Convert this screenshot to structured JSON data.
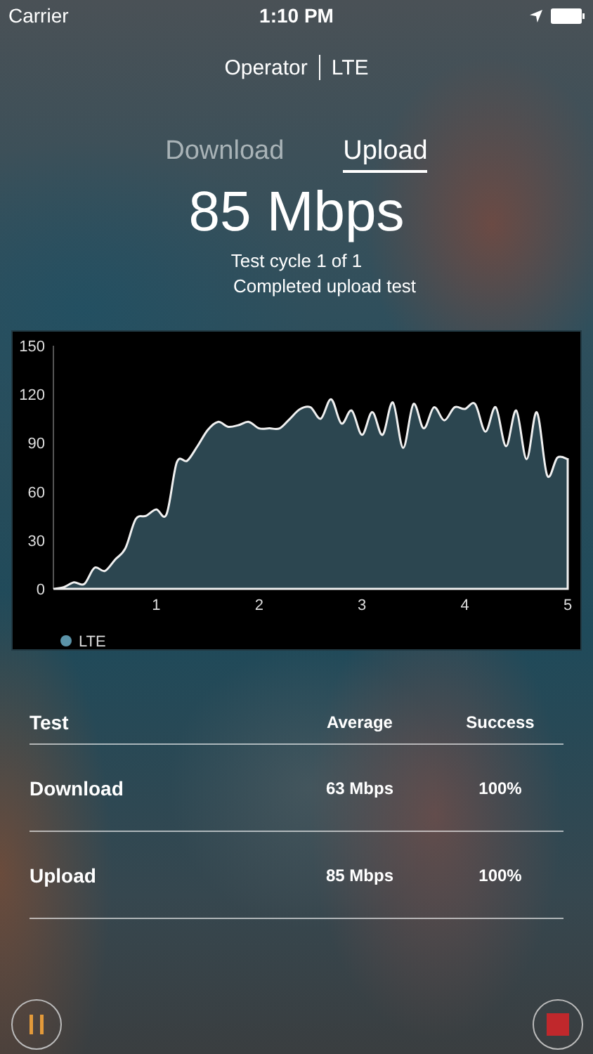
{
  "status_bar": {
    "carrier": "Carrier",
    "time": "1:10 PM"
  },
  "connection": {
    "operator": "Operator",
    "network": "LTE"
  },
  "tabs": [
    {
      "label": "Download",
      "selected": false
    },
    {
      "label": "Upload",
      "selected": true
    }
  ],
  "speed": "85 Mbps",
  "cycle": "Test cycle  1 of 1",
  "status": "Completed upload test",
  "chart_data": {
    "type": "area",
    "x": [
      0,
      0.1,
      0.2,
      0.3,
      0.4,
      0.5,
      0.6,
      0.7,
      0.8,
      0.9,
      1,
      1.1,
      1.2,
      1.3,
      1.4,
      1.5,
      1.6,
      1.7,
      1.8,
      1.9,
      2,
      2.1,
      2.2,
      2.3,
      2.4,
      2.5,
      2.6,
      2.7,
      2.8,
      2.9,
      3,
      3.1,
      3.2,
      3.3,
      3.4,
      3.5,
      3.6,
      3.7,
      3.8,
      3.9,
      4,
      4.1,
      4.2,
      4.3,
      4.4,
      4.5,
      4.6,
      4.7,
      4.8,
      4.9,
      5
    ],
    "series": [
      {
        "name": "LTE",
        "color": "#5b93a8",
        "values": [
          0,
          1,
          4,
          3,
          13,
          11,
          18,
          25,
          43,
          45,
          49,
          46,
          78,
          79,
          88,
          98,
          103,
          100,
          101,
          103,
          99,
          99,
          99,
          105,
          111,
          112,
          105,
          117,
          102,
          110,
          95,
          109,
          95,
          115,
          87,
          114,
          99,
          112,
          104,
          112,
          111,
          114,
          97,
          112,
          88,
          110,
          80,
          109,
          70,
          81,
          80
        ]
      }
    ],
    "xlim": [
      0,
      5
    ],
    "ylim": [
      0,
      150
    ],
    "xticks": [
      1,
      2,
      3,
      4,
      5
    ],
    "yticks": [
      0,
      30,
      60,
      90,
      120,
      150
    ]
  },
  "results": {
    "columns": [
      "Test",
      "Average",
      "Success"
    ],
    "rows": [
      {
        "test": "Download",
        "average": "63 Mbps",
        "success": "100%"
      },
      {
        "test": "Upload",
        "average": "85 Mbps",
        "success": "100%"
      }
    ]
  }
}
